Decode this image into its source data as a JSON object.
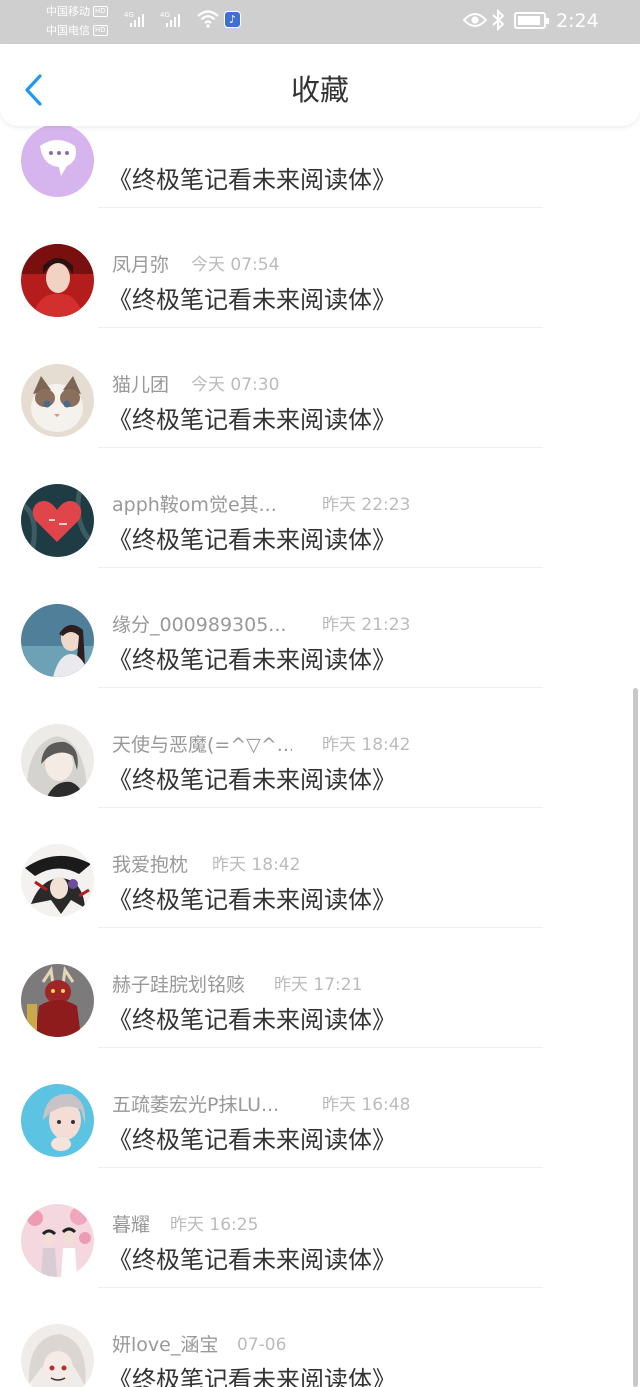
{
  "status_bar": {
    "carrier_1": "中国移动",
    "carrier_2": "中国电信",
    "hd_badge": "HD",
    "network_1": "4G",
    "network_2": "4G",
    "time": "2:24"
  },
  "header": {
    "title": "收藏",
    "back_icon": "chevron-left-icon"
  },
  "favorites": [
    {
      "username": "",
      "time": "",
      "title": "《终极笔记看未来阅读体》"
    },
    {
      "username": "凤月弥",
      "time": "今天 07:54",
      "title": "《终极笔记看未来阅读体》"
    },
    {
      "username": "猫儿团",
      "time": "今天 07:30",
      "title": "《终极笔记看未来阅读体》"
    },
    {
      "username": "apph鞍om觉e其...",
      "time": "昨天 22:23",
      "title": "《终极笔记看未来阅读体》"
    },
    {
      "username": "缘分_000989305...",
      "time": "昨天 21:23",
      "title": "《终极笔记看未来阅读体》"
    },
    {
      "username": "天使与恶魔(=^▽^...",
      "time": "昨天 18:42",
      "title": "《终极笔记看未来阅读体》"
    },
    {
      "username": "我爱抱枕",
      "time": "昨天 18:42",
      "title": "《终极笔记看未来阅读体》"
    },
    {
      "username": "赫子跬脘划铭赅",
      "time": "昨天 17:21",
      "title": "《终极笔记看未来阅读体》"
    },
    {
      "username": "五疏萎宏光P抹LU...",
      "time": "昨天 16:48",
      "title": "《终极笔记看未来阅读体》"
    },
    {
      "username": "暮耀",
      "time": "昨天 16:25",
      "title": "《终极笔记看未来阅读体》"
    },
    {
      "username": "妍love_涵宝",
      "time": "07-06",
      "title": "《终极笔记看未来阅读体》"
    }
  ],
  "colors": {
    "accent": "#2196f3",
    "title_text": "#333333",
    "username_text": "#999999",
    "time_text": "#bbbbbb",
    "status_bar": "#cfcfcf"
  }
}
